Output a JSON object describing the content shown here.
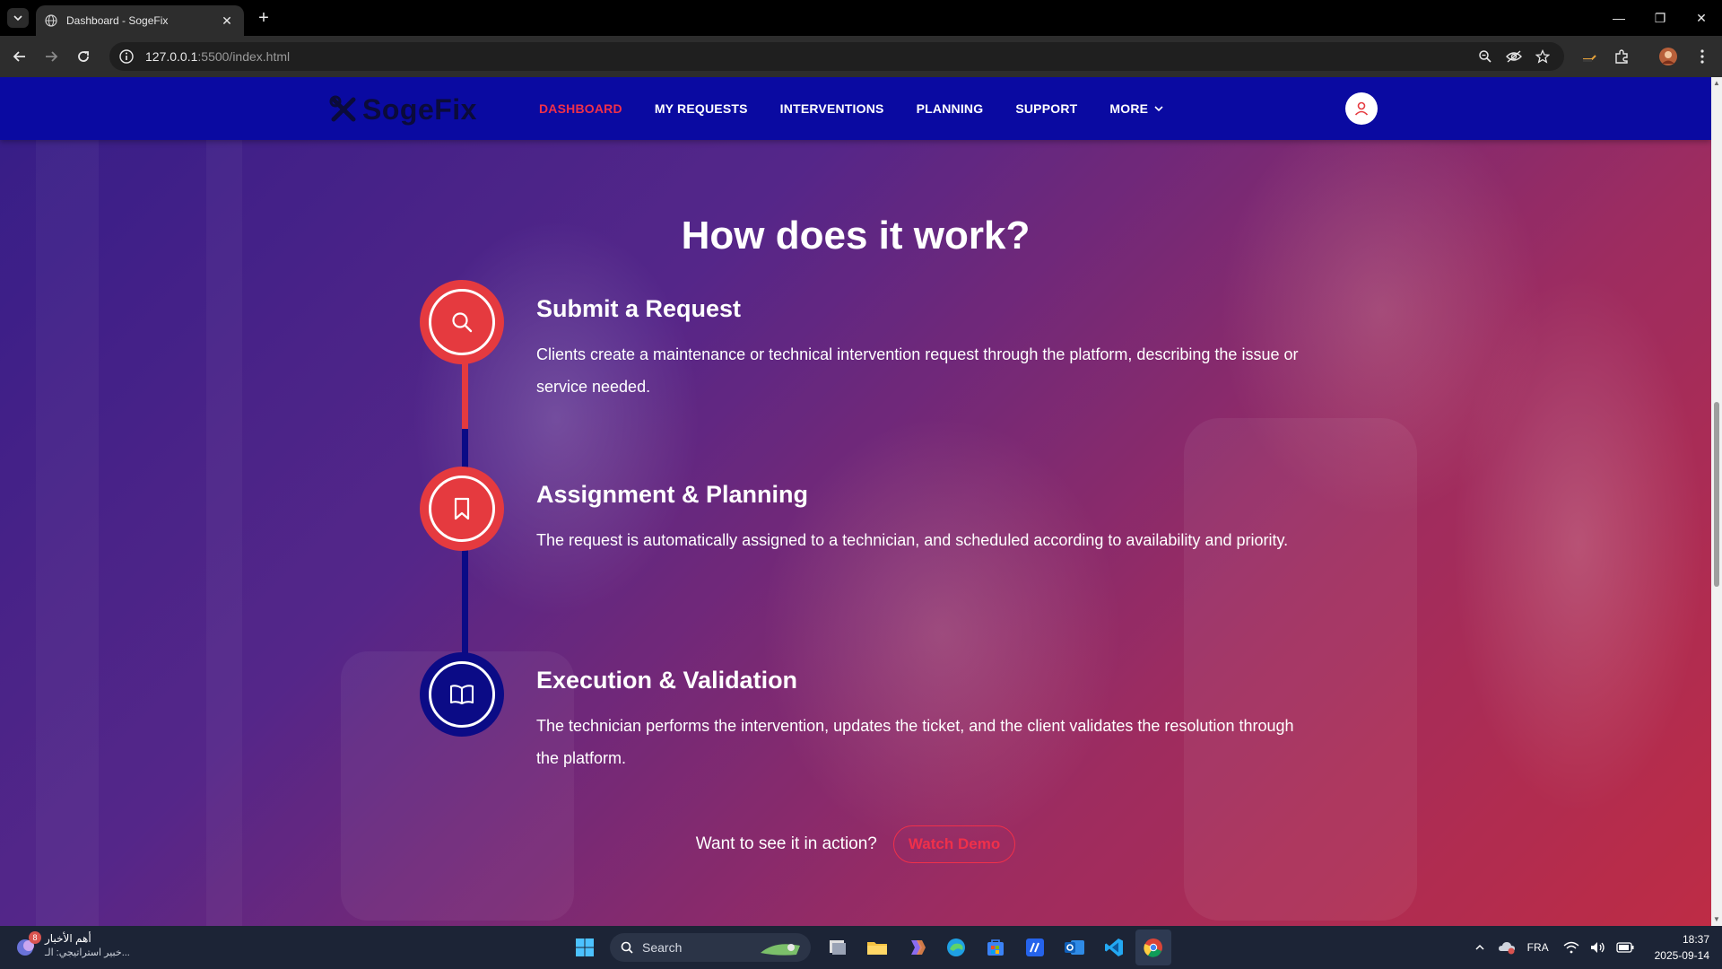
{
  "browser": {
    "tab_title": "Dashboard - SogeFix",
    "url_host": "127.0.0.1",
    "url_path": ":5500/index.html"
  },
  "header": {
    "logo_text": "SogeFix",
    "nav": [
      {
        "label": "DASHBOARD",
        "active": true
      },
      {
        "label": "MY REQUESTS"
      },
      {
        "label": "INTERVENTIONS"
      },
      {
        "label": "PLANNING"
      },
      {
        "label": "SUPPORT"
      },
      {
        "label": "MORE"
      }
    ]
  },
  "section": {
    "title": "How does it work?",
    "steps": [
      {
        "icon": "search-icon",
        "title": "Submit a Request",
        "description": "Clients create a maintenance or technical intervention request through the platform, describing the issue or service needed."
      },
      {
        "icon": "bookmark-icon",
        "title": "Assignment & Planning",
        "description": "The request is automatically assigned to a technician, and scheduled according to availability and priority."
      },
      {
        "icon": "book-icon",
        "title": "Execution & Validation",
        "description": "The technician performs the intervention, updates the ticket, and the client validates the resolution through the platform."
      }
    ],
    "cta_text": "Want to see it in action?",
    "cta_button": "Watch Demo"
  },
  "colors": {
    "header_bg": "#0a0aa1",
    "accent_red": "#e53a3f",
    "accent_navy": "#0b0b86",
    "active_link": "#f0304a"
  },
  "taskbar": {
    "news_badge": "8",
    "news_title": "أهم الأخبار",
    "news_sub": "خبير استراتيجي: الـ...",
    "search_label": "Search",
    "language": "FRA",
    "time": "18:37",
    "date": "2025-09-14"
  }
}
